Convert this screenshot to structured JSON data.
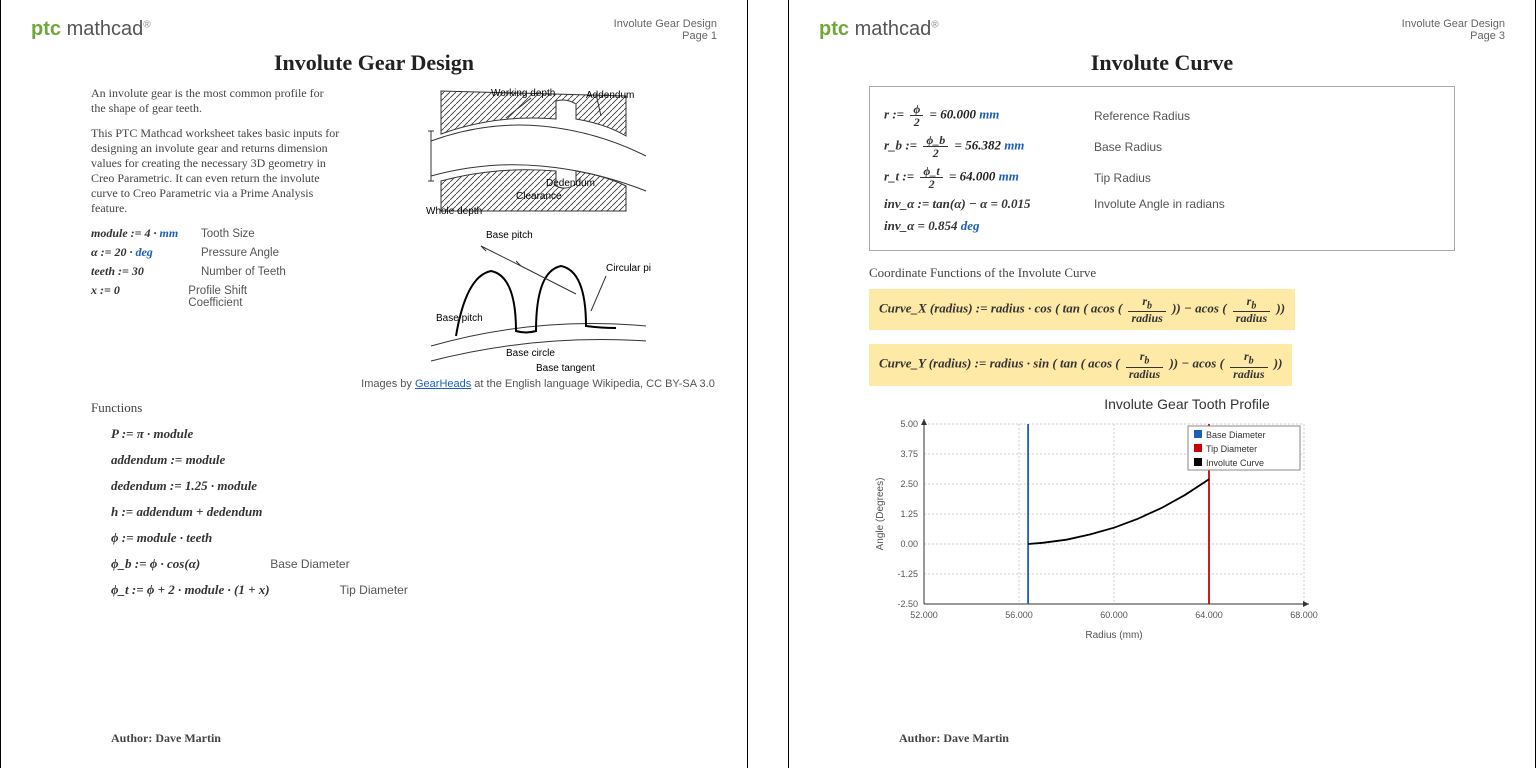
{
  "brand": {
    "ptc": "ptc",
    "mathcad": "mathcad",
    "reg": "®"
  },
  "doc_title": "Involute Gear Design",
  "page1_label": "Page 1",
  "page3_label": "Page 3",
  "p1": {
    "title": "Involute Gear Design",
    "intro1": "An involute gear is the most common profile for the shape of gear teeth.",
    "intro2": "This PTC Mathcad worksheet takes basic inputs for designing an involute gear and returns dimension values for creating the necessary 3D geometry in Creo Parametric. It can even return the involute curve to Creo Parametric via a Prime Analysis feature.",
    "params": [
      {
        "exp": "module := 4 · ",
        "unit": "mm",
        "desc": "Tooth Size"
      },
      {
        "exp": "α := 20 · ",
        "unit": "deg",
        "desc": "Pressure Angle"
      },
      {
        "exp": "teeth := 30",
        "unit": "",
        "desc": "Number of Teeth"
      },
      {
        "exp": "x := 0",
        "unit": "",
        "desc": "Profile Shift Coefficient"
      }
    ],
    "diagram_labels": {
      "wd": "Working depth",
      "add": "Addendum",
      "ded": "Dedendum",
      "clr": "Clearance",
      "whole": "Whole depth",
      "bp": "Base pitch",
      "cp": "Circular pitch",
      "bpitch": "Base pitch",
      "bcircle": "Base circle",
      "btan": "Base tangent"
    },
    "caption_pre": "Images by ",
    "caption_link": "GearHeads",
    "caption_post": " at the English language Wikipedia, CC BY-SA 3.0",
    "sect_fn": "Functions",
    "fns": [
      {
        "e": "P := π · module",
        "l": ""
      },
      {
        "e": "addendum := module",
        "l": ""
      },
      {
        "e": "dedendum := 1.25 · module",
        "l": ""
      },
      {
        "e": "h := addendum + dedendum",
        "l": ""
      },
      {
        "e": "ϕ := module · teeth",
        "l": ""
      },
      {
        "e": "ϕ_b := ϕ · cos(α)",
        "l": "Base Diameter"
      },
      {
        "e": "ϕ_t := ϕ + 2 · module · (1 + x)",
        "l": "Tip Diameter"
      }
    ],
    "author": "Author: Dave Martin"
  },
  "p3": {
    "title": "Involute Curve",
    "box": [
      {
        "sym": "r",
        "num": "ϕ",
        "den": "2",
        "val": "60.000",
        "unit": "mm",
        "desc": "Reference Radius"
      },
      {
        "sym": "r_b",
        "num": "ϕ_b",
        "den": "2",
        "val": "56.382",
        "unit": "mm",
        "desc": "Base Radius"
      },
      {
        "sym": "r_t",
        "num": "ϕ_t",
        "den": "2",
        "val": "64.000",
        "unit": "mm",
        "desc": "Tip Radius"
      }
    ],
    "inv1": "inv_α := tan(α) − α = 0.015",
    "inv1d": "Involute Angle in radians",
    "inv2": "inv_α = 0.854 ",
    "inv2u": "deg",
    "sect_coord": "Coordinate Functions of the Involute Curve",
    "curvex_pre": "Curve_X (radius) := radius · cos ( tan ( acos (",
    "curvex_mid": " )) − acos (",
    "curvex_post": " ))",
    "curvey_pre": "Curve_Y (radius) := radius · sin ( tan ( acos (",
    "chart_title": "Involute Gear Tooth Profile",
    "legend": [
      "Base Diameter",
      "Tip Diameter",
      "Involute Curve"
    ],
    "xlabel": "Radius (mm)",
    "ylabel": "Angle (Degrees)",
    "author": "Author: Dave Martin"
  },
  "chart_data": {
    "type": "line",
    "title": "Involute Gear Tooth Profile",
    "xlabel": "Radius (mm)",
    "ylabel": "Angle (Degrees)",
    "xlim": [
      52,
      68
    ],
    "ylim": [
      -2.5,
      5.0
    ],
    "xticks": [
      52,
      56,
      60,
      64,
      68
    ],
    "yticks": [
      -2.5,
      -1.25,
      0.0,
      1.25,
      2.5,
      3.75,
      5.0
    ],
    "series": [
      {
        "name": "Base Diameter",
        "color": "#1b5fb8",
        "x": [
          56.382,
          56.382
        ],
        "y": [
          -2.5,
          5.0
        ]
      },
      {
        "name": "Tip Diameter",
        "color": "#cc0000",
        "x": [
          64.0,
          64.0
        ],
        "y": [
          -2.5,
          5.0
        ]
      },
      {
        "name": "Involute Curve",
        "color": "#000000",
        "x": [
          56.382,
          57.0,
          58.0,
          59.0,
          60.0,
          61.0,
          62.0,
          63.0,
          64.0
        ],
        "y": [
          0.0,
          0.05,
          0.18,
          0.4,
          0.68,
          1.05,
          1.5,
          2.05,
          2.7
        ]
      }
    ],
    "legend_position": "top-right"
  }
}
